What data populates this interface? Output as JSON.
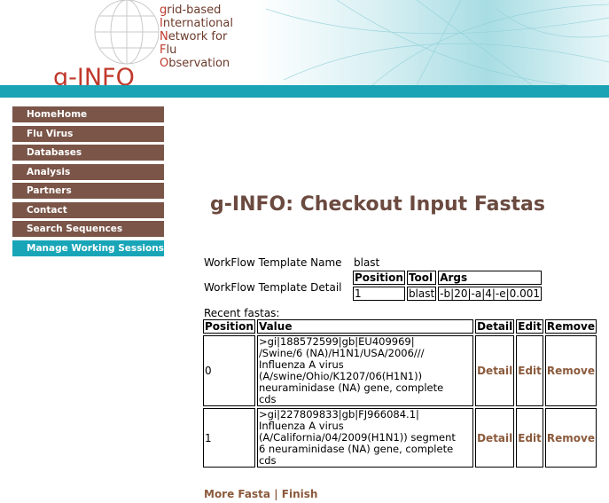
{
  "logo": {
    "brand": "g-INFO",
    "lines": [
      {
        "initial": "g",
        "rest": "rid-based"
      },
      {
        "initial": "I",
        "rest": "nternational"
      },
      {
        "initial": "N",
        "rest": "etwork for"
      },
      {
        "initial": "F",
        "rest": "lu"
      },
      {
        "initial": "O",
        "rest": "bservation"
      }
    ]
  },
  "nav": {
    "items": [
      {
        "label": "HomeHome",
        "active": false
      },
      {
        "label": "Flu Virus",
        "active": false
      },
      {
        "label": "Databases",
        "active": false
      },
      {
        "label": "Analysis",
        "active": false
      },
      {
        "label": "Partners",
        "active": false
      },
      {
        "label": "Contact",
        "active": false
      },
      {
        "label": "Search Sequences",
        "active": false
      },
      {
        "label": "Manage Working Sessions",
        "active": true
      }
    ]
  },
  "page": {
    "title": "g-INFO: Checkout Input Fastas",
    "workflow_name_label": "WorkFlow Template Name",
    "workflow_name_value": "blast",
    "workflow_detail_label": "WorkFlow Template Detail",
    "recent_label": "Recent fastas:"
  },
  "detail_table": {
    "headers": [
      "Position",
      "Tool",
      "Args"
    ],
    "rows": [
      [
        "1",
        "blast",
        "-b|20|-a|4|-e|0.001"
      ]
    ]
  },
  "fasta_table": {
    "headers": [
      "Position",
      "Value",
      "Detail",
      "Edit",
      "Remove"
    ],
    "rows": [
      {
        "position": "0",
        "value_lines": [
          ">gi|188572599|gb|EU409969|",
          "/Swine/6 (NA)/H1N1/USA/2006///",
          "Influenza A virus",
          "(A/swine/Ohio/K1207/06(H1N1))",
          "neuraminidase (NA) gene, complete",
          "cds"
        ],
        "detail": "Detail",
        "edit": "Edit",
        "remove": "Remove"
      },
      {
        "position": "1",
        "value_lines": [
          ">gi|227809833|gb|FJ966084.1|",
          "Influenza A virus",
          "(A/California/04/2009(H1N1)) segment",
          "6 neuraminidase (NA) gene, complete",
          "cds"
        ],
        "detail": "Detail",
        "edit": "Edit",
        "remove": "Remove"
      }
    ]
  },
  "footer": {
    "more_fasta": "More Fasta",
    "separator": "|",
    "finish": "Finish"
  },
  "colors": {
    "nav_bg": "#7a5548",
    "nav_active": "#19a5b8",
    "teal_bar": "#1aa3b5",
    "title": "#6b4a40",
    "link": "#8b5a3c"
  }
}
